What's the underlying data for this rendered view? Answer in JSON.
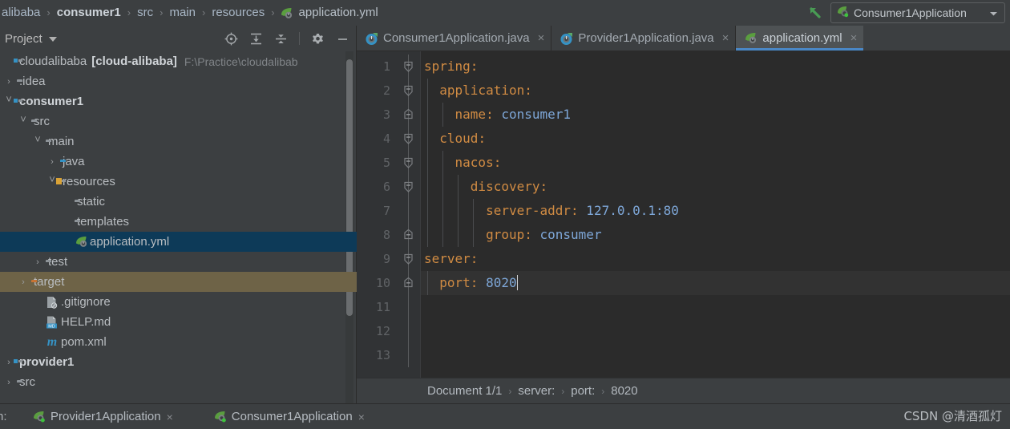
{
  "window": {
    "breadcrumb": [
      {
        "text": "alibaba",
        "style": "normal"
      },
      {
        "text": "consumer1",
        "style": "bold"
      },
      {
        "text": "src",
        "style": "normal"
      },
      {
        "text": "main",
        "style": "normal"
      },
      {
        "text": "resources",
        "style": "normal"
      },
      {
        "text": "application.yml",
        "style": "file",
        "icon": "spring-yaml-icon"
      }
    ],
    "run_config": {
      "name": "Consumer1Application",
      "icon": "spring-boot-run-icon",
      "dropdown_icon": "chevron-down-icon"
    },
    "nav_back_icon": "arrow-up-left-icon",
    "separator": "›"
  },
  "project_panel": {
    "title": "Project",
    "title_caret_icon": "chevron-down-icon",
    "tools": [
      {
        "name": "select-opened-file-icon",
        "label": "Select Opened File"
      },
      {
        "name": "expand-all-icon",
        "label": "Expand All"
      },
      {
        "name": "collapse-all-icon",
        "label": "Collapse All"
      },
      {
        "name": "settings-gear-icon",
        "label": "Settings"
      },
      {
        "name": "hide-panel-icon",
        "label": "Hide"
      }
    ],
    "tree": [
      {
        "id": "cloudalibaba",
        "label": "cloudalibaba",
        "bracket": "[cloud-alibaba]",
        "path": "F:\\Practice\\cloudalibab",
        "indent": 0,
        "twisty": "",
        "icon": "module-folder-icon",
        "bold": false,
        "state": "normal"
      },
      {
        "id": "idea",
        "label": ".idea",
        "indent": 0,
        "twisty": "›",
        "icon": "folder-icon",
        "bold": false,
        "state": "normal"
      },
      {
        "id": "consumer1",
        "label": "consumer1",
        "indent": 0,
        "twisty": "˅",
        "icon": "module-folder-icon",
        "bold": true,
        "state": "normal"
      },
      {
        "id": "src",
        "label": "src",
        "indent": 1,
        "twisty": "˅",
        "icon": "folder-icon",
        "bold": false,
        "state": "normal"
      },
      {
        "id": "main",
        "label": "main",
        "indent": 2,
        "twisty": "˅",
        "icon": "folder-icon",
        "bold": false,
        "state": "normal"
      },
      {
        "id": "java",
        "label": "java",
        "indent": 3,
        "twisty": "›",
        "icon": "source-folder-icon",
        "bold": false,
        "state": "normal"
      },
      {
        "id": "resources",
        "label": "resources",
        "indent": 3,
        "twisty": "˅",
        "icon": "resources-folder-icon",
        "bold": false,
        "state": "normal"
      },
      {
        "id": "static",
        "label": "static",
        "indent": 4,
        "twisty": "",
        "icon": "folder-icon",
        "bold": false,
        "state": "normal"
      },
      {
        "id": "templates",
        "label": "templates",
        "indent": 4,
        "twisty": "",
        "icon": "folder-icon",
        "bold": false,
        "state": "normal"
      },
      {
        "id": "application-yml",
        "label": "application.yml",
        "indent": 4,
        "twisty": "",
        "icon": "spring-yaml-icon",
        "bold": false,
        "state": "selected"
      },
      {
        "id": "test",
        "label": "test",
        "indent": 2,
        "twisty": "›",
        "icon": "folder-icon",
        "bold": false,
        "state": "normal"
      },
      {
        "id": "target",
        "label": "target",
        "indent": 1,
        "twisty": "›",
        "icon": "excluded-folder-icon",
        "bold": false,
        "state": "highlighted"
      },
      {
        "id": "gitignore",
        "label": ".gitignore",
        "indent": 2,
        "twisty": "",
        "icon": "gitignore-file-icon",
        "bold": false,
        "state": "normal"
      },
      {
        "id": "help-md",
        "label": "HELP.md",
        "indent": 2,
        "twisty": "",
        "icon": "markdown-file-icon",
        "bold": false,
        "state": "normal"
      },
      {
        "id": "pom-xml",
        "label": "pom.xml",
        "indent": 2,
        "twisty": "",
        "icon": "maven-file-icon",
        "bold": false,
        "state": "normal"
      },
      {
        "id": "provider1",
        "label": "provider1",
        "indent": 0,
        "twisty": "›",
        "icon": "module-folder-icon",
        "bold": true,
        "state": "normal"
      },
      {
        "id": "provider1-src",
        "label": "src",
        "indent": 0,
        "twisty": "›",
        "icon": "folder-icon",
        "bold": false,
        "state": "normal"
      }
    ]
  },
  "editor": {
    "tabs": [
      {
        "label": "Consumer1Application.java",
        "icon": "java-spring-class-icon",
        "active": false,
        "close_icon": "close-icon"
      },
      {
        "label": "Provider1Application.java",
        "icon": "java-spring-class-icon",
        "active": false,
        "close_icon": "close-icon"
      },
      {
        "label": "application.yml",
        "icon": "spring-yaml-icon",
        "active": true,
        "close_icon": "close-icon"
      }
    ],
    "line_numbers": [
      "1",
      "2",
      "3",
      "4",
      "5",
      "6",
      "7",
      "8",
      "9",
      "10",
      "11",
      "12",
      "13"
    ],
    "lines": [
      {
        "n": 1,
        "indent": 0,
        "key": "spring",
        "value": "",
        "fold": "expanded-top",
        "current": false
      },
      {
        "n": 2,
        "indent": 1,
        "key": "application",
        "value": "",
        "fold": "expanded",
        "current": false
      },
      {
        "n": 3,
        "indent": 2,
        "key": "name",
        "value": "consumer1",
        "fold": "end",
        "current": false
      },
      {
        "n": 4,
        "indent": 1,
        "key": "cloud",
        "value": "",
        "fold": "expanded",
        "current": false
      },
      {
        "n": 5,
        "indent": 2,
        "key": "nacos",
        "value": "",
        "fold": "expanded",
        "current": false
      },
      {
        "n": 6,
        "indent": 3,
        "key": "discovery",
        "value": "",
        "fold": "expanded",
        "current": false
      },
      {
        "n": 7,
        "indent": 4,
        "key": "server-addr",
        "value": "127.0.0.1:80",
        "fold": "none",
        "current": false
      },
      {
        "n": 8,
        "indent": 4,
        "key": "group",
        "value": "consumer",
        "fold": "end",
        "current": false
      },
      {
        "n": 9,
        "indent": 0,
        "key": "server",
        "value": "",
        "fold": "expanded-top",
        "current": false
      },
      {
        "n": 10,
        "indent": 1,
        "key": "port",
        "value": "8020",
        "fold": "end",
        "current": true
      },
      {
        "n": 11,
        "indent": 0,
        "key": "",
        "value": "",
        "fold": "none",
        "current": false
      },
      {
        "n": 12,
        "indent": 0,
        "key": "",
        "value": "",
        "fold": "none",
        "current": false
      },
      {
        "n": 13,
        "indent": 0,
        "key": "",
        "value": "",
        "fold": "none",
        "current": false
      }
    ],
    "status_breadcrumb": [
      "Document 1/1",
      "server:",
      "port:",
      "8020"
    ],
    "status_separator": "›"
  },
  "run_panel": {
    "label": "n:",
    "tabs": [
      {
        "label": "Provider1Application",
        "icon": "spring-boot-run-icon",
        "active": false,
        "close_icon": "close-icon"
      },
      {
        "label": "Consumer1Application",
        "icon": "spring-boot-run-icon",
        "active": false,
        "close_icon": "close-icon"
      }
    ]
  },
  "watermark": "CSDN @清酒孤灯",
  "colors": {
    "background": "#3c3f41",
    "editor_background": "#2b2b2b",
    "gutter": "#313335",
    "selection": "#0d3a58",
    "excluded_highlight": "#6e6347",
    "accent_blue": "#4a88c7",
    "yaml_key": "#d08b43",
    "yaml_value": "#7ea7d8",
    "text": "#b9bdc1"
  }
}
